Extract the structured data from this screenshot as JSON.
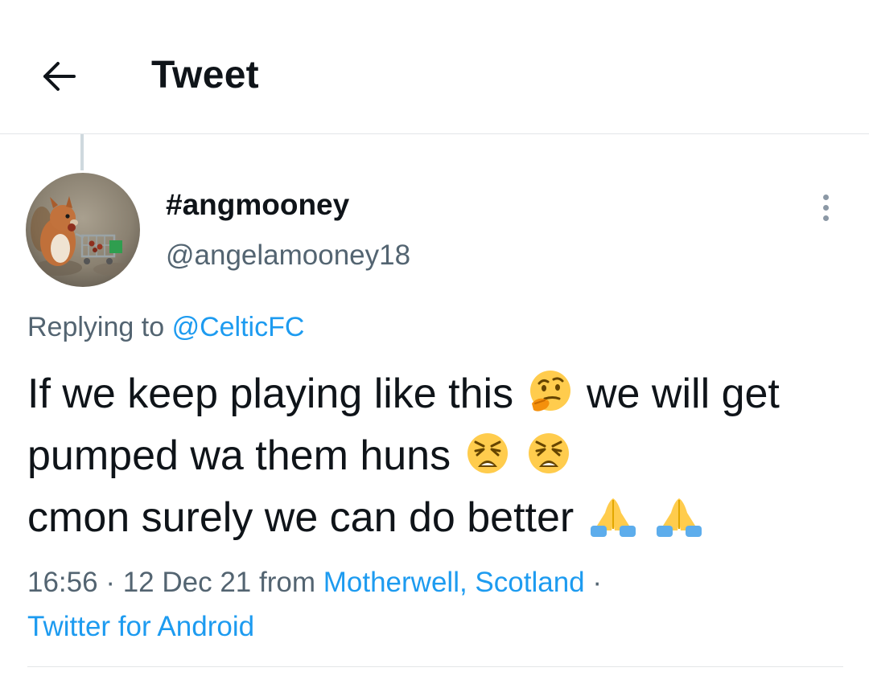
{
  "header": {
    "back_icon": "arrow-left-icon",
    "title": "Tweet"
  },
  "tweet": {
    "author": {
      "display_name": "#angmooney",
      "handle": "@angelamooney18",
      "avatar": "avatar-squirrel-with-shopping-cart"
    },
    "more_icon": "more-vertical-icon",
    "replying_to_label": "Replying to",
    "replying_to_handle": "@CelticFC",
    "text_parts": {
      "part1": "If we keep playing like this",
      "part2": "we will get pumped wa them huns",
      "part3": "cmon surely we can do better"
    },
    "emojis": [
      "thinking-face",
      "weary-face",
      "weary-face",
      "folded-hands",
      "folded-hands"
    ],
    "time": "16:56",
    "date": "12 Dec 21",
    "from_label": "from",
    "location": "Motherwell, Scotland",
    "source": "Twitter for Android"
  },
  "colors": {
    "link": "#1d9bf0",
    "secondary_text": "#536471",
    "primary_text": "#0f1419",
    "divider": "#e3e6e8"
  }
}
